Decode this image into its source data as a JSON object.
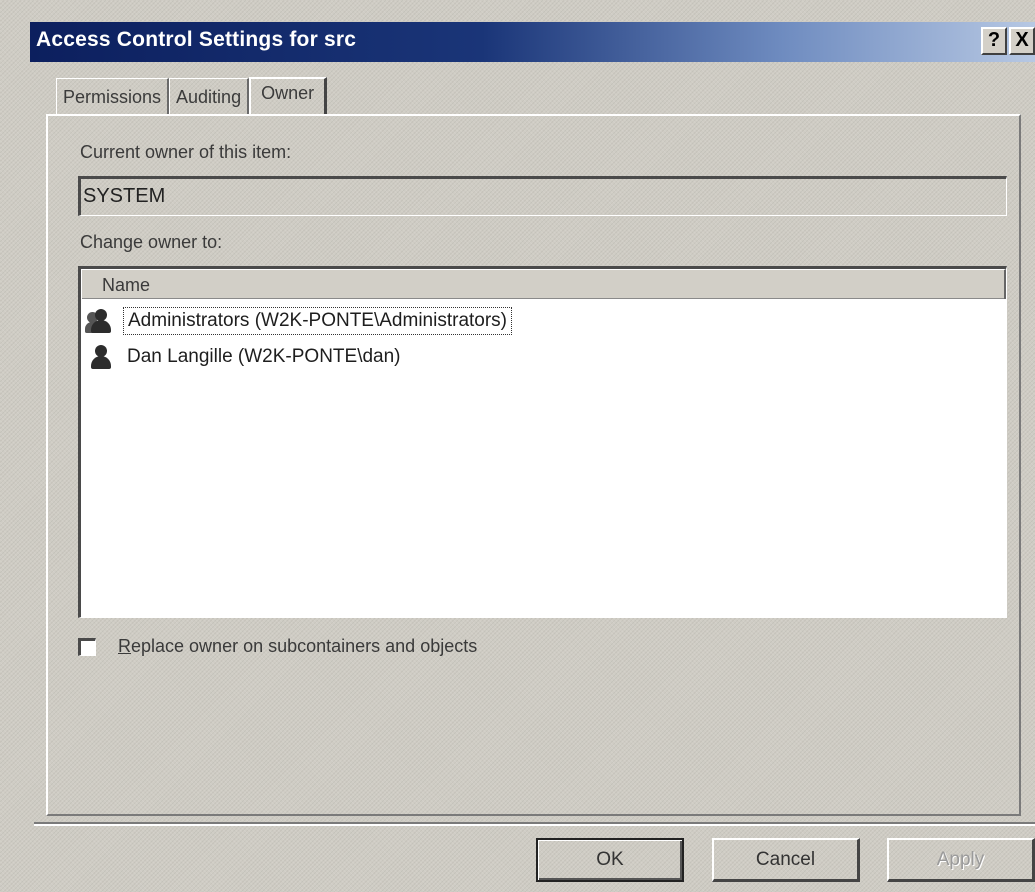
{
  "window": {
    "title": "Access Control Settings for src",
    "help_button": "?",
    "close_button": "X"
  },
  "tabs": [
    {
      "label": "Permissions",
      "active": false
    },
    {
      "label": "Auditing",
      "active": false
    },
    {
      "label": "Owner",
      "active": true
    }
  ],
  "owner": {
    "current_label": "Current owner of this item:",
    "current_value": "SYSTEM",
    "change_label": "Change owner to:"
  },
  "list": {
    "column_header": "Name",
    "items": [
      {
        "label": "Administrators (W2K-PONTE\\Administrators)",
        "icon": "group-icon",
        "selected": true
      },
      {
        "label": "Dan Langille (W2K-PONTE\\dan)",
        "icon": "user-icon",
        "selected": false
      }
    ]
  },
  "options": {
    "replace_owner_label_prefix": "R",
    "replace_owner_label_rest": "eplace owner on subcontainers and objects",
    "replace_owner_checked": false
  },
  "buttons": {
    "ok": "OK",
    "cancel": "Cancel",
    "apply": "Apply"
  }
}
